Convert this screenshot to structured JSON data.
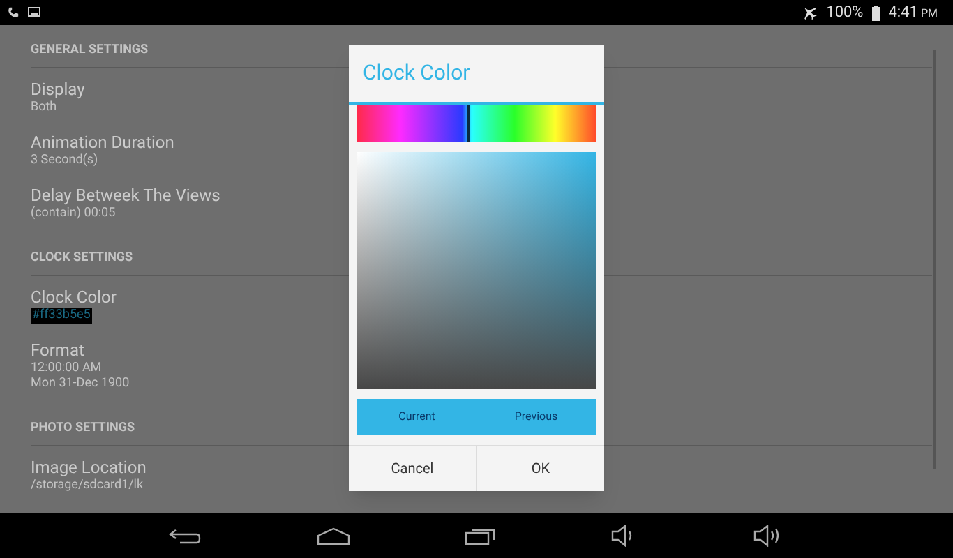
{
  "status_bar": {
    "battery": "100%",
    "time": "4:41",
    "time_suffix": "PM"
  },
  "settings": [
    {
      "kind": "header",
      "title": "GENERAL SETTINGS"
    },
    {
      "kind": "item",
      "title": "Display",
      "lines": [
        "Both"
      ]
    },
    {
      "kind": "item",
      "title": "Animation Duration",
      "lines": [
        "3 Second(s)"
      ]
    },
    {
      "kind": "item",
      "title": "Delay Betweek The Views",
      "lines": [
        "(contain) 00:05"
      ]
    },
    {
      "kind": "header",
      "title": "CLOCK SETTINGS"
    },
    {
      "kind": "color",
      "title": "Clock Color",
      "lines": [
        "#ff33b5e5"
      ]
    },
    {
      "kind": "item",
      "title": "Format",
      "lines": [
        "12:00:00 AM",
        "Mon 31-Dec 1900"
      ]
    },
    {
      "kind": "header",
      "title": "PHOTO SETTINGS"
    },
    {
      "kind": "item",
      "title": "Image Location",
      "lines": [
        "/storage/sdcard1/lk"
      ]
    }
  ],
  "dialog": {
    "title": "Clock Color",
    "hue_slider": {
      "level": 0.46
    },
    "current_label": "Current",
    "previous_label": "Previous",
    "buttons": [
      "Cancel",
      "OK"
    ]
  }
}
